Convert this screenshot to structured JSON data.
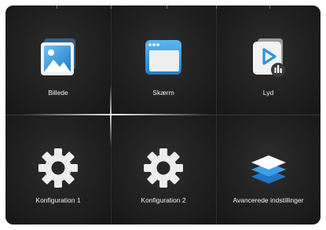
{
  "menu": {
    "items": [
      {
        "label": "Billede",
        "icon": "picture-icon"
      },
      {
        "label": "Skærm",
        "icon": "display-window-icon"
      },
      {
        "label": "Lyd",
        "icon": "audio-play-icon"
      },
      {
        "label": "Konfiguration 1",
        "icon": "gear-icon"
      },
      {
        "label": "Konfiguration 2",
        "icon": "gear-icon"
      },
      {
        "label": "Avancerede indstillinger",
        "icon": "layers-icon"
      }
    ]
  },
  "colors": {
    "panel_background": "#151515",
    "tile_center": "#2e2e2e",
    "label_text": "#f2f2f2",
    "icon_light": "#e8e8e8",
    "accent_blue": "#3aa0e8"
  }
}
